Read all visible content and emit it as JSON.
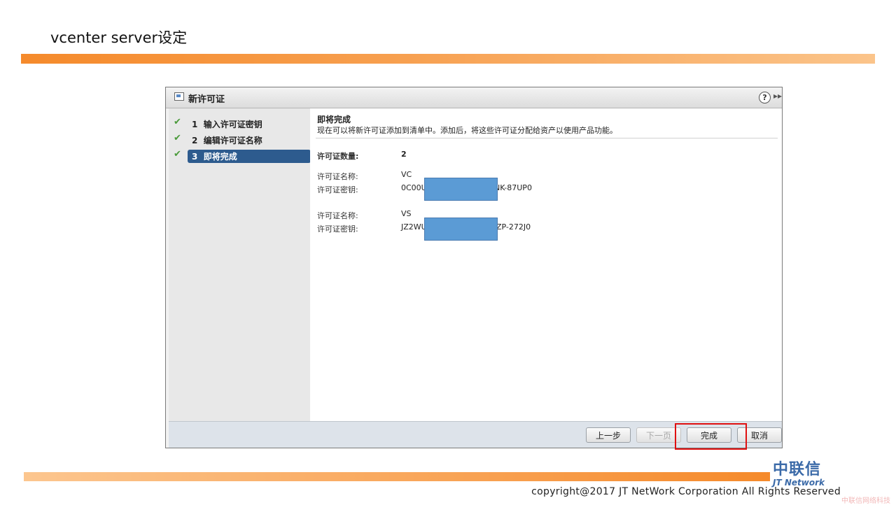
{
  "slide": {
    "title": "vcenter server设定",
    "copyright": "copyright@2017  JT NetWork Corporation All Rights Reserved",
    "logo_cn": "中联信",
    "logo_en": "JT Network",
    "watermark": "中联信网络科技"
  },
  "dialog": {
    "title": "新许可证",
    "help_icon": "?",
    "expand_icon": "▸▸"
  },
  "sidebar": {
    "steps": [
      {
        "number": "1",
        "label": "输入许可证密钥",
        "done": true
      },
      {
        "number": "2",
        "label": "编辑许可证名称",
        "done": true
      },
      {
        "number": "3",
        "label": "即将完成",
        "done": true,
        "active": true
      }
    ]
  },
  "content": {
    "heading": "即将完成",
    "description": "现在可以将新许可证添加到清单中。添加后，将这些许可证分配给资产以使用产品功能。",
    "count_label": "许可证数量:",
    "count_value": "2",
    "licenses": [
      {
        "name_label": "许可证名称:",
        "name": "VC",
        "key_label": "许可证密钥:",
        "key_prefix": "0C00U",
        "key_suffix": "NK-87UP0"
      },
      {
        "name_label": "许可证名称:",
        "name": "VS",
        "key_label": "许可证密钥:",
        "key_prefix": "JZ2WU",
        "key_suffix": "ZP-272J0"
      }
    ]
  },
  "buttons": {
    "back": "上一步",
    "next": "下一页",
    "finish": "完成",
    "cancel": "取消"
  },
  "colors": {
    "band_orange": "#f58a2b",
    "active_step": "#2d5b8e",
    "redaction": "#5b9bd5",
    "highlight_border": "#e01010"
  }
}
